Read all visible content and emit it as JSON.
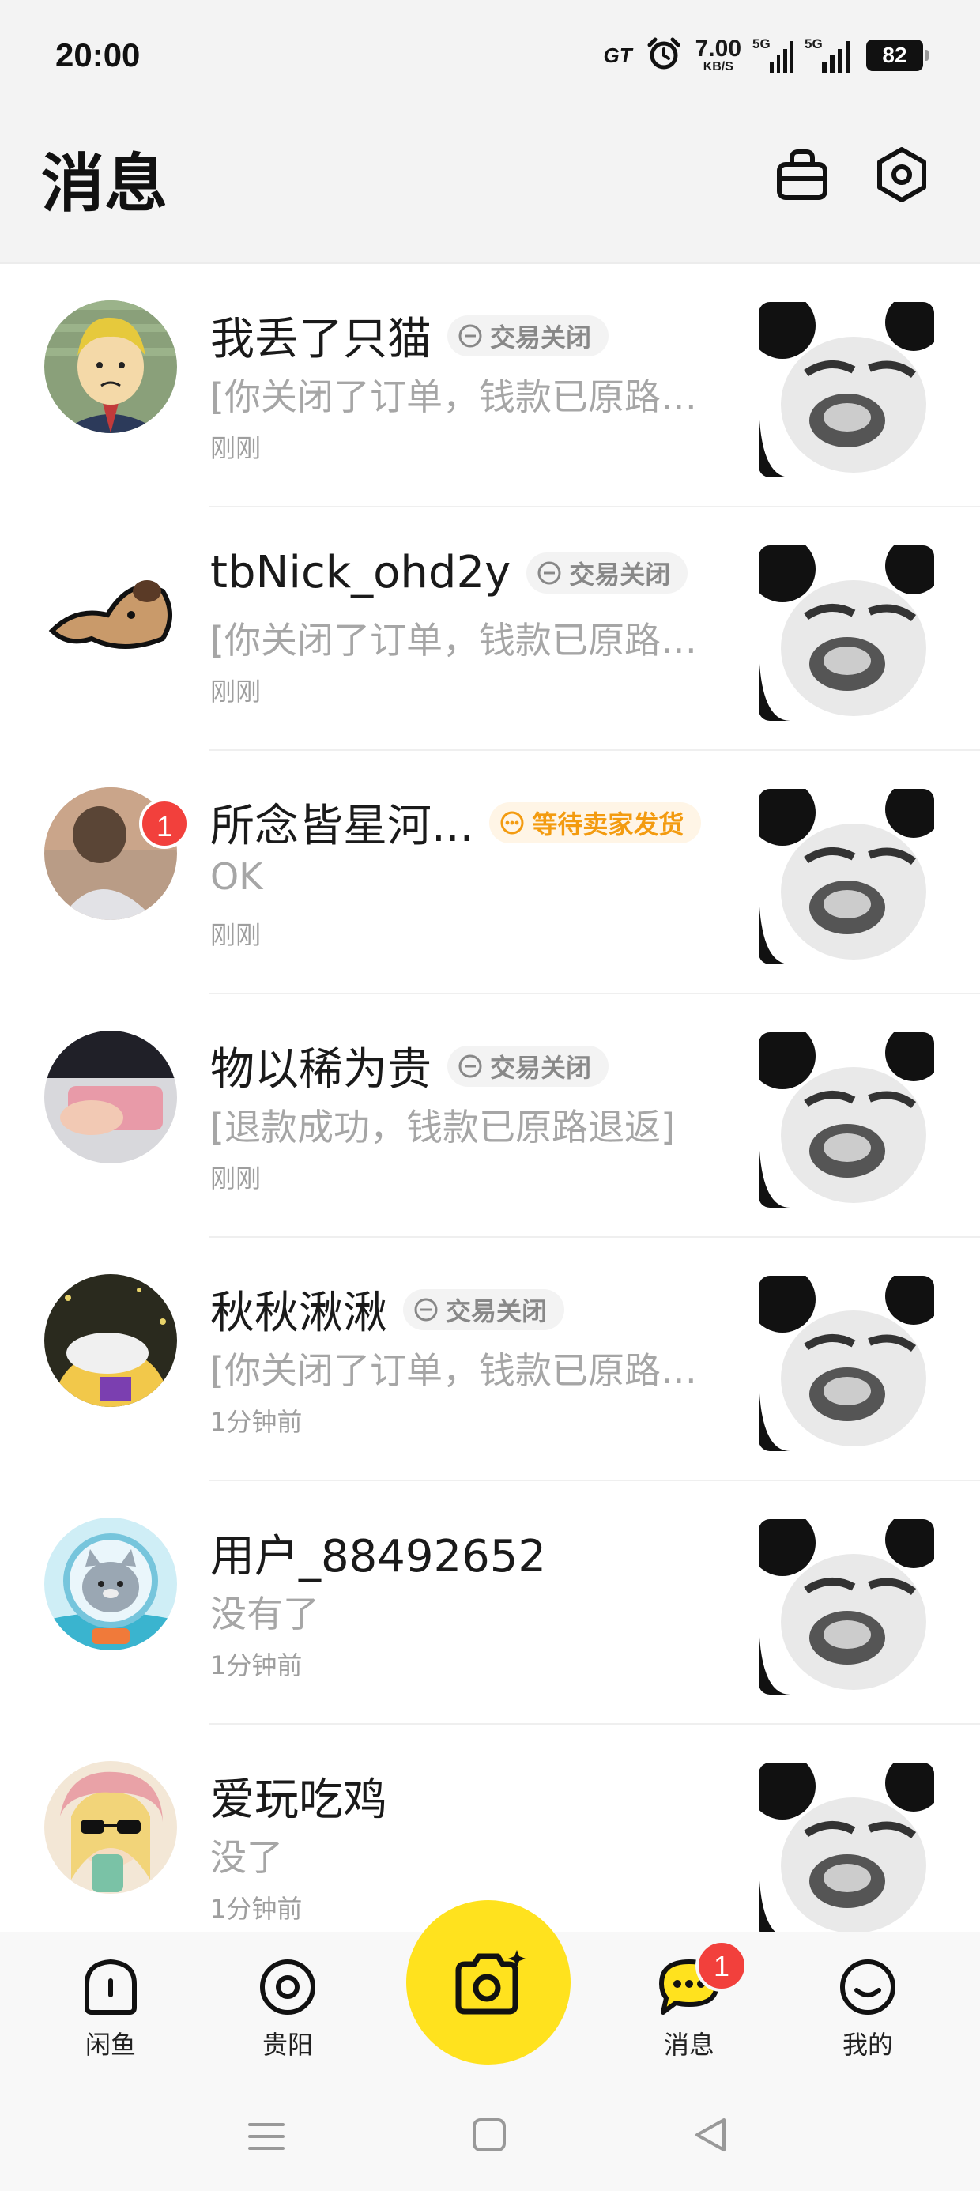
{
  "status_bar": {
    "time": "20:00",
    "gt_label": "GT",
    "net_speed": "7.00",
    "net_unit": "KB/S",
    "sim1": "5G",
    "sim2": "5G",
    "battery": "82",
    "icons": [
      "gt-mode-icon",
      "alarm-icon",
      "signal-icon",
      "battery-icon"
    ]
  },
  "header": {
    "title": "消息",
    "actions": [
      "bag-icon",
      "settings-icon"
    ]
  },
  "conversations": [
    {
      "name": "我丢了只猫",
      "tag": "交易关闭",
      "tag_style": "closed",
      "preview": "[你关闭了订单，钱款已原路退返]",
      "time": "刚刚",
      "unread": null
    },
    {
      "name": "tbNick_ohd2y",
      "tag": "交易关闭",
      "tag_style": "closed",
      "preview": "[你关闭了订单，钱款已原路退返]",
      "time": "刚刚",
      "unread": null
    },
    {
      "name": "所念皆星河...",
      "tag": "等待卖家发货",
      "tag_style": "waiting",
      "preview": "OK",
      "time": "刚刚",
      "unread": "1"
    },
    {
      "name": "物以稀为贵",
      "tag": "交易关闭",
      "tag_style": "closed",
      "preview": "[退款成功，钱款已原路退返]",
      "time": "刚刚",
      "unread": null
    },
    {
      "name": "秋秋湫湫",
      "tag": "交易关闭",
      "tag_style": "closed",
      "preview": "[你关闭了订单，钱款已原路退返]",
      "time": "1分钟前",
      "unread": null
    },
    {
      "name": "用户_88492652",
      "tag": null,
      "tag_style": null,
      "preview": "没有了",
      "time": "1分钟前",
      "unread": null
    },
    {
      "name": "爱玩吃鸡",
      "tag": null,
      "tag_style": null,
      "preview": "没了",
      "time": "1分钟前",
      "unread": null
    }
  ],
  "bottom_nav": {
    "home": "闲鱼",
    "city": "贵阳",
    "messages": "消息",
    "messages_badge": "1",
    "mine": "我的"
  },
  "colors": {
    "accent_yellow": "#ffe21e",
    "badge_red": "#f2403c",
    "waiting_orange": "#f39b10"
  }
}
